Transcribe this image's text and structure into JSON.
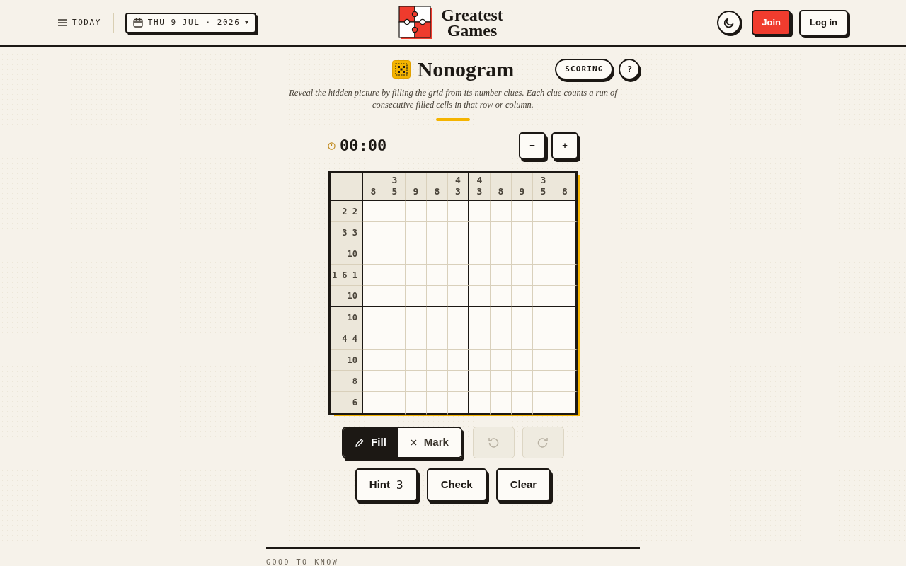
{
  "header": {
    "menu": {
      "label": "TODAY"
    },
    "date_picker": {
      "label": "THU 9 JUL · 2026"
    },
    "logo": {
      "text": "Greatest Games"
    },
    "buttons": [
      {
        "kind": "theme"
      },
      {
        "kind": "primary",
        "label": "Join"
      },
      {
        "kind": "secondary",
        "label": "Log in"
      }
    ]
  },
  "puzzle": {
    "title": "Nonogram",
    "title_buttons": [
      {
        "kind": "pill",
        "label": "SCORING"
      },
      {
        "kind": "circle",
        "label": "?"
      }
    ],
    "description": "Reveal the hidden picture by filling the grid from its number clues. Each clue counts a run of consecutive filled cells in that row or column.",
    "timer": "00:00",
    "zoom_buttons": [
      {
        "label": "−"
      },
      {
        "label": "+"
      }
    ],
    "column_clues": [
      [
        "8"
      ],
      [
        "3",
        "5"
      ],
      [
        "9"
      ],
      [
        "8"
      ],
      [
        "4",
        "3"
      ],
      [
        "4",
        "3"
      ],
      [
        "8"
      ],
      [
        "9"
      ],
      [
        "3",
        "5"
      ],
      [
        "8"
      ]
    ],
    "row_clues": [
      "2 2",
      "3 3",
      "10",
      "1 6 1",
      "10",
      "10",
      "4 4",
      "10",
      "8",
      "6"
    ],
    "modes": [
      {
        "kind": "fill",
        "label": "Fill",
        "selected": true
      },
      {
        "kind": "mark",
        "label": "Mark",
        "selected": false
      }
    ],
    "history_buttons": [
      {
        "kind": "undo",
        "disabled": true
      },
      {
        "kind": "redo",
        "disabled": true
      }
    ],
    "actions": [
      {
        "label": "Hint",
        "count": "3"
      },
      {
        "label": "Check"
      },
      {
        "label": "Clear"
      }
    ]
  },
  "section": {
    "heading": "GOOD TO KNOW"
  }
}
